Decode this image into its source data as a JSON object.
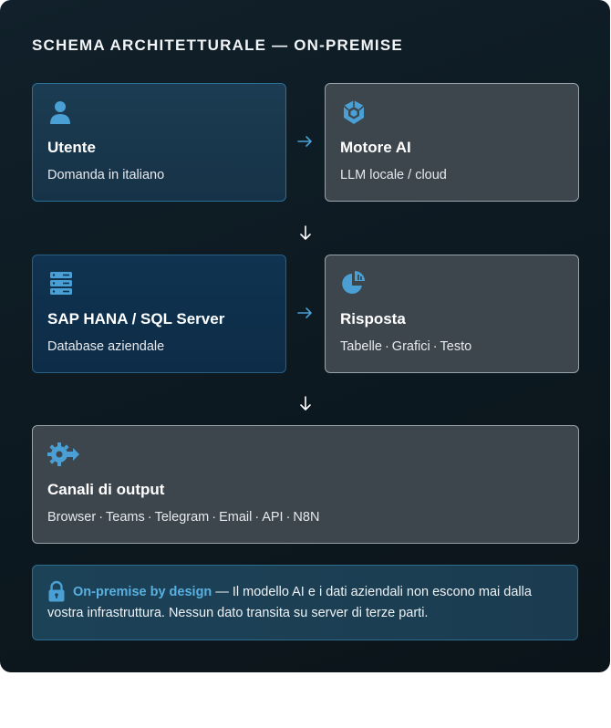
{
  "title": "SCHEMA ARCHITETTURALE — ON-PREMISE",
  "cards": {
    "utente": {
      "title": "Utente",
      "subtitle": "Domanda in italiano",
      "icon": "user-icon"
    },
    "motore": {
      "title": "Motore AI",
      "subtitle": "LLM locale / cloud",
      "icon": "ai-cube-icon"
    },
    "database": {
      "title": "SAP HANA / SQL Server",
      "subtitle": "Database aziendale",
      "icon": "server-icon"
    },
    "risposta": {
      "title": "Risposta",
      "subtitle_items": [
        "Tabelle",
        "Grafici",
        "Testo"
      ],
      "icon": "pie-chart-icon"
    },
    "canali": {
      "title": "Canali di output",
      "subtitle_items": [
        "Browser",
        "Teams",
        "Telegram",
        "Email",
        "API",
        "N8N"
      ],
      "icon": "gear-arrow-icon"
    }
  },
  "separator": "·",
  "note": {
    "highlight": "On-premise by design",
    "text": " — Il modello AI e i dati aziendali non escono mai dalla vostra infrastruttura. Nessun dato transita su server di terze parti.",
    "icon": "lock-icon"
  },
  "colors": {
    "accent": "#5ab0e0",
    "icon_blue": "#4a9fd4",
    "arrow": "#4a9fd4",
    "arrow_down": "#ffffff"
  }
}
